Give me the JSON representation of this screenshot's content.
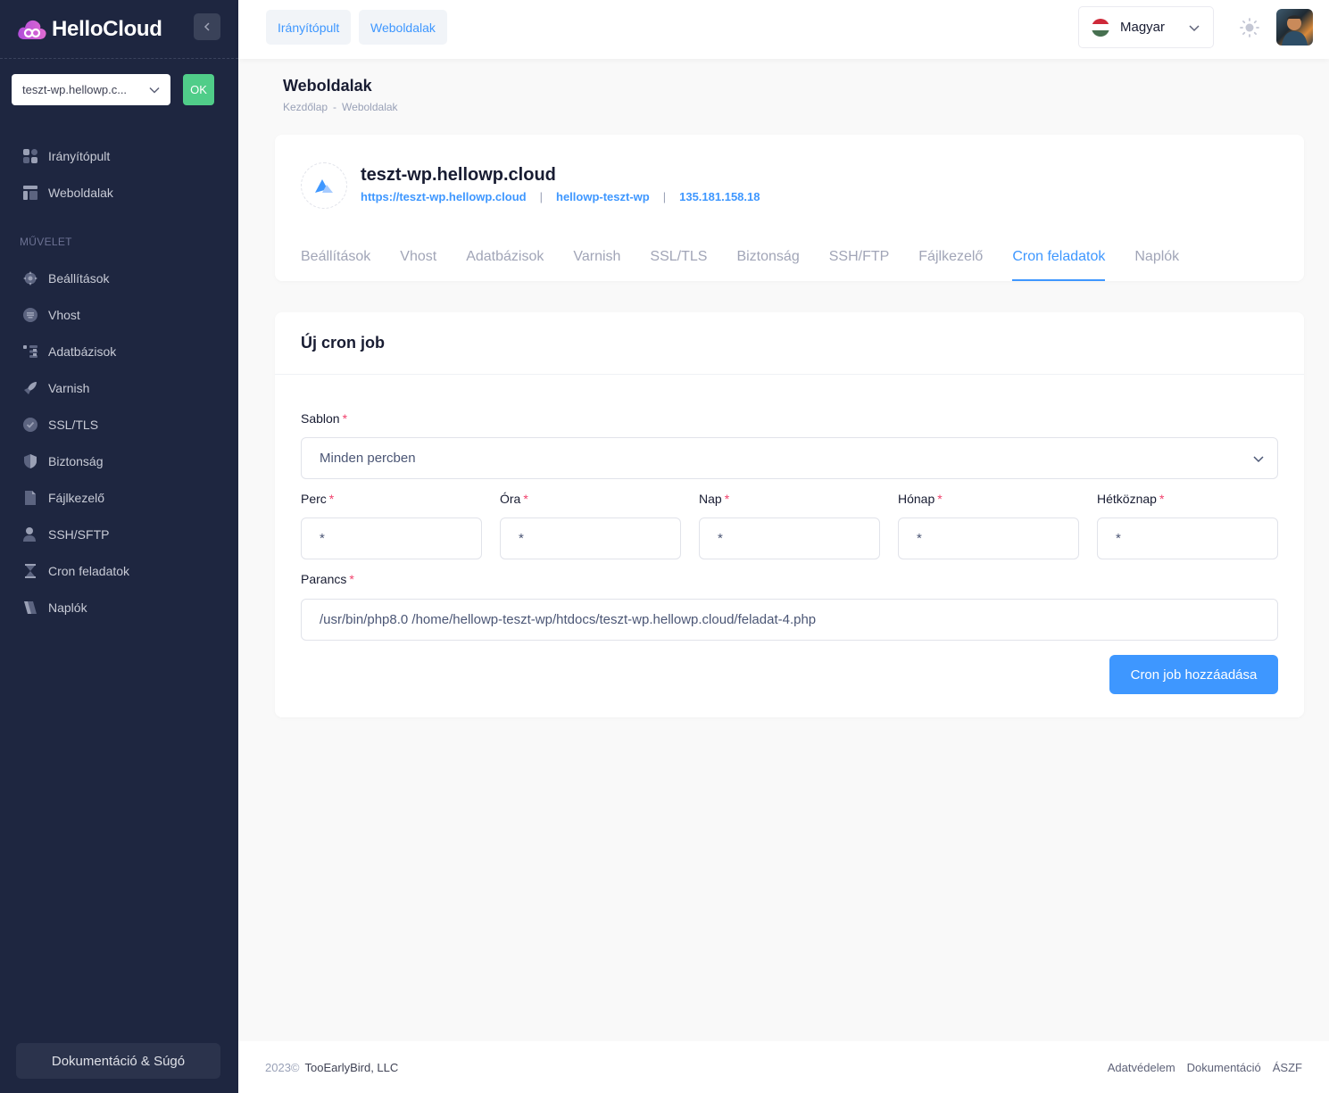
{
  "brand": {
    "name": "HelloCloud"
  },
  "site_selector": {
    "value": "teszt-wp.hellowp.c...",
    "ok_label": "OK"
  },
  "sidebar": {
    "top_items": [
      {
        "label": "Irányítópult",
        "icon": "dashboard-icon"
      },
      {
        "label": "Weboldalak",
        "icon": "layout-icon"
      }
    ],
    "section_label": "MŰVELET",
    "items": [
      {
        "label": "Beállítások",
        "icon": "gear-icon"
      },
      {
        "label": "Vhost",
        "icon": "server-icon"
      },
      {
        "label": "Adatbázisok",
        "icon": "database-icon"
      },
      {
        "label": "Varnish",
        "icon": "rocket-icon"
      },
      {
        "label": "SSL/TLS",
        "icon": "shield-check-icon"
      },
      {
        "label": "Biztonság",
        "icon": "shield-icon"
      },
      {
        "label": "Fájlkezelő",
        "icon": "file-icon"
      },
      {
        "label": "SSH/SFTP",
        "icon": "user-key-icon"
      },
      {
        "label": "Cron feladatok",
        "icon": "hourglass-icon"
      },
      {
        "label": "Naplók",
        "icon": "scroll-icon"
      }
    ],
    "doc_button": "Dokumentáció & Súgó"
  },
  "header": {
    "nav_dashboard": "Irányítópult",
    "nav_websites": "Weboldalak",
    "language": "Magyar",
    "flag_colors": [
      "#ce2939",
      "#ffffff",
      "#477050"
    ]
  },
  "page": {
    "title": "Weboldalak",
    "breadcrumb": [
      "Kezdőlap",
      "-",
      "Weboldalak"
    ]
  },
  "site": {
    "name": "teszt-wp.hellowp.cloud",
    "url": "https://teszt-wp.hellowp.cloud",
    "user": "hellowp-teszt-wp",
    "ip": "135.181.158.18",
    "tabs": [
      "Beállítások",
      "Vhost",
      "Adatbázisok",
      "Varnish",
      "SSL/TLS",
      "Biztonság",
      "SSH/FTP",
      "Fájlkezelő",
      "Cron feladatok",
      "Naplók"
    ],
    "active_tab": "Cron feladatok"
  },
  "form": {
    "title": "Új cron job",
    "template_label": "Sablon",
    "template_value": "Minden percben",
    "minute_label": "Perc",
    "minute_value": "*",
    "hour_label": "Óra",
    "hour_value": "*",
    "day_label": "Nap",
    "day_value": "*",
    "month_label": "Hónap",
    "month_value": "*",
    "weekday_label": "Hétköznap",
    "weekday_value": "*",
    "command_label": "Parancs",
    "command_value": "/usr/bin/php8.0 /home/hellowp-teszt-wp/htdocs/teszt-wp.hellowp.cloud/feladat-4.php",
    "required_mark": "*",
    "submit_label": "Cron job hozzáadása"
  },
  "footer": {
    "year": "2023©",
    "company": "TooEarlyBird, LLC",
    "links": [
      "Adatvédelem",
      "Dokumentáció",
      "ÁSZF"
    ]
  },
  "colors": {
    "accent": "#3e97ff",
    "sidebar_bg": "#1e2640",
    "ok_green": "#50cd89",
    "required": "#f1416c"
  }
}
